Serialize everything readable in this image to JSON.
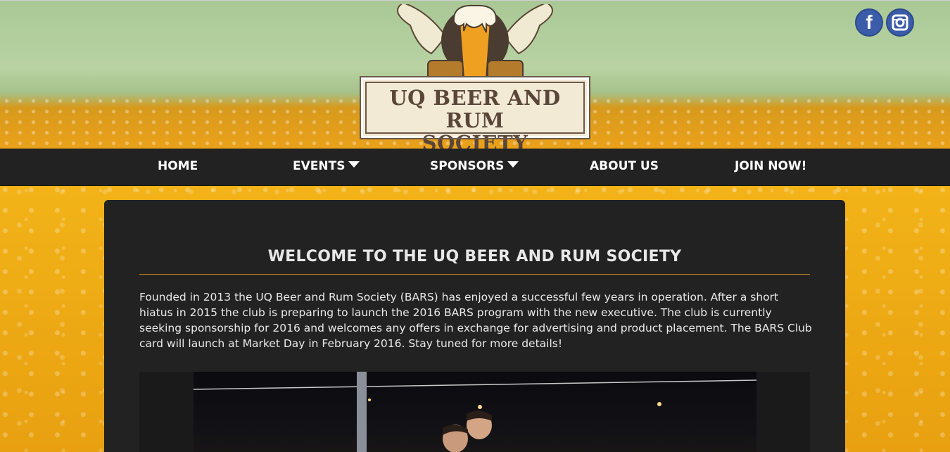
{
  "logo": {
    "line1": "UQ BEER AND RUM",
    "line2": "SOCIETY"
  },
  "social": [
    {
      "name": "facebook-icon",
      "glyph": "f"
    },
    {
      "name": "instagram-icon"
    }
  ],
  "nav": {
    "items": [
      {
        "label": "HOME",
        "dropdown": false
      },
      {
        "label": "EVENTS",
        "dropdown": true
      },
      {
        "label": "SPONSORS",
        "dropdown": true
      },
      {
        "label": "ABOUT US",
        "dropdown": false
      },
      {
        "label": "JOIN NOW!",
        "dropdown": false
      }
    ]
  },
  "main": {
    "title": "WELCOME TO THE UQ BEER AND RUM SOCIETY",
    "body": "Founded in 2013 the UQ Beer and Rum Society (BARS) has enjoyed a successful few years in operation. After a short hiatus in 2015 the club is preparing to launch the 2016 BARS program with the new executive. The club is currently seeking sponsorship for 2016 and welcomes any offers in exchange for advertising and product placement. The BARS Club card will launch at Market Day in February 2016. Stay tuned for more details!"
  },
  "colors": {
    "nav_bg": "#222222",
    "panel_bg": "#222222",
    "accent_rule": "#d98f1e",
    "social_blue": "#3b5ca8"
  }
}
